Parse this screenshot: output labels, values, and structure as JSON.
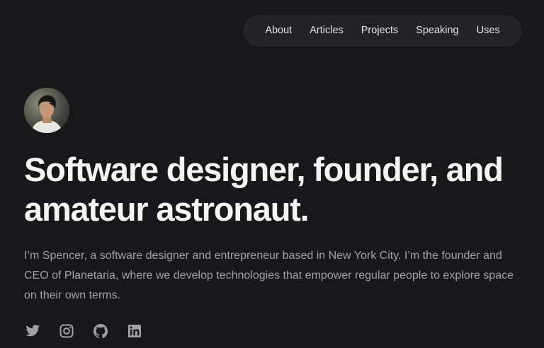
{
  "nav": {
    "items": [
      {
        "label": "About"
      },
      {
        "label": "Articles"
      },
      {
        "label": "Projects"
      },
      {
        "label": "Speaking"
      },
      {
        "label": "Uses"
      }
    ]
  },
  "hero": {
    "headline": "Software designer, founder, and amateur astronaut.",
    "bio": "I’m Spencer, a software designer and entrepreneur based in New York City. I’m the founder and CEO of Planetaria, where we develop technologies that empower regular people to explore space on their own terms."
  },
  "socials": [
    {
      "icon": "twitter-icon"
    },
    {
      "icon": "instagram-icon"
    },
    {
      "icon": "github-icon"
    },
    {
      "icon": "linkedin-icon"
    }
  ],
  "colors": {
    "background": "#18181b",
    "nav_background": "#232326",
    "headline": "#f4f4f5",
    "body_text": "#a1a1aa",
    "icon": "#a1a1aa"
  }
}
